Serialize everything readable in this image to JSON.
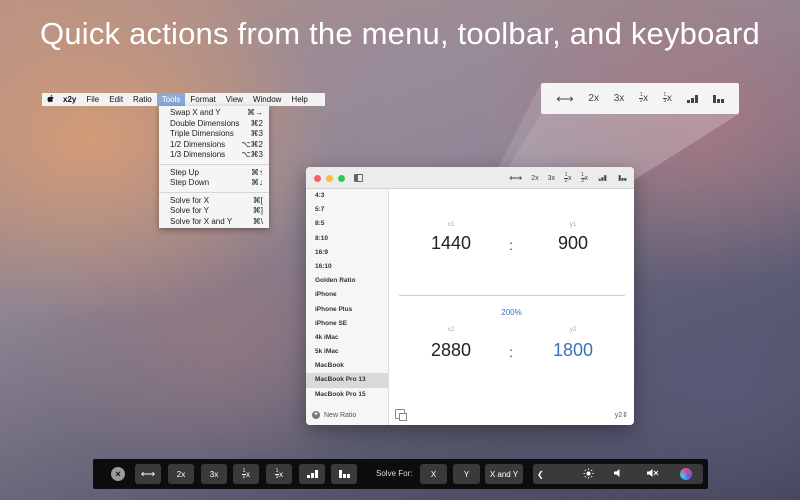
{
  "headline": "Quick actions from the menu, toolbar, and keyboard",
  "menubar": {
    "apple": "",
    "app": "x2y",
    "items": [
      "File",
      "Edit",
      "Ratio",
      "Tools",
      "Format",
      "View",
      "Window",
      "Help"
    ]
  },
  "tools_menu": {
    "items": [
      {
        "label": "Swap X and Y",
        "shortcut": "⌘→"
      },
      {
        "label": "Double Dimensions",
        "shortcut": "⌘2"
      },
      {
        "label": "Triple Dimensions",
        "shortcut": "⌘3"
      },
      {
        "label": "1/2 Dimensions",
        "shortcut": "⌥⌘2"
      },
      {
        "label": "1/3 Dimensions",
        "shortcut": "⌥⌘3"
      },
      {
        "label": "Step Up",
        "shortcut": "⌘↑"
      },
      {
        "label": "Step Down",
        "shortcut": "⌘↓"
      },
      {
        "label": "Solve for X",
        "shortcut": "⌘["
      },
      {
        "label": "Solve for Y",
        "shortcut": "⌘]"
      },
      {
        "label": "Solve for X and Y",
        "shortcut": "⌘\\"
      }
    ]
  },
  "toolbar": {
    "swap_glyph": "⟷",
    "double_label": "2x",
    "triple_label": "3x",
    "half": {
      "num": "1",
      "den": "2",
      "suffix": "x"
    },
    "third": {
      "num": "1",
      "den": "3",
      "suffix": "x"
    }
  },
  "sidebar": {
    "items": [
      "4:3",
      "5:7",
      "8:5",
      "8:10",
      "16:9",
      "16:10",
      "Golden Ratio",
      "iPhone",
      "iPhone Plus",
      "iPhone SE",
      "4k iMac",
      "5k iMac",
      "MacBook",
      "MacBook Pro 13",
      "MacBook Pro 15"
    ],
    "selected": "MacBook Pro 13",
    "new_ratio": "New Ratio"
  },
  "ratio": {
    "x1_label": "x1",
    "y1_label": "y1",
    "x1": "1440",
    "y1": "900",
    "separator": ":",
    "percent": "200%",
    "x2_label": "x2",
    "y2_label": "y2",
    "x2": "2880",
    "y2": "1800",
    "solve_select": "y2"
  },
  "touchbar": {
    "solve_for_label": "Solve For:",
    "x_label": "X",
    "y_label": "Y",
    "xy_label": "X and Y",
    "chevron": "❮"
  },
  "colors": {
    "accent_blue": "#3a72b8",
    "menu_highlight": "#8aa9d6"
  }
}
